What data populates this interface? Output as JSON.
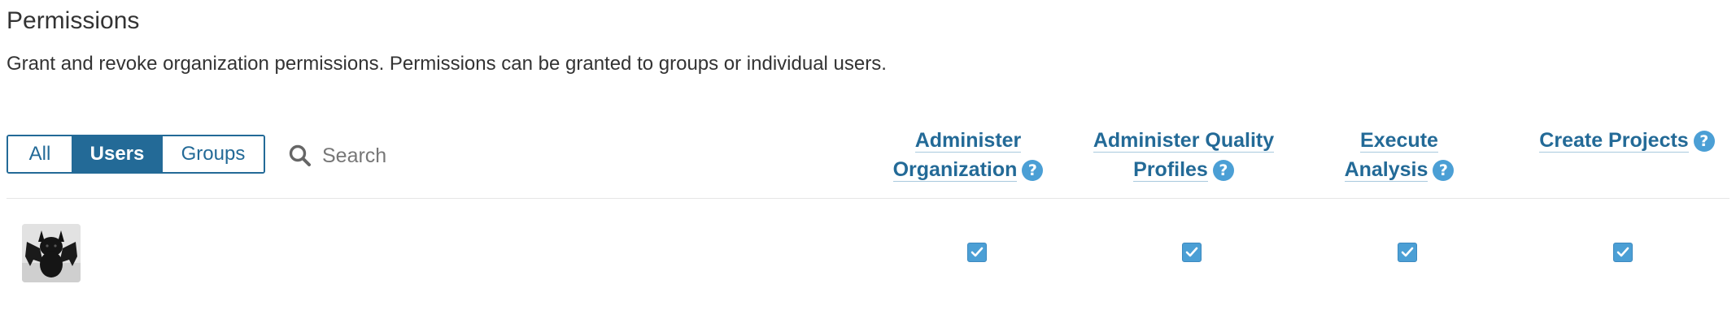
{
  "page": {
    "title": "Permissions",
    "description": "Grant and revoke organization permissions. Permissions can be granted to groups or individual users."
  },
  "filter": {
    "options": [
      "All",
      "Users",
      "Groups"
    ],
    "selected": "Users"
  },
  "search": {
    "placeholder": "Search",
    "value": ""
  },
  "permissions": [
    {
      "name_line1": "Administer",
      "name_line2": "Organization"
    },
    {
      "name_line1": "Administer Quality",
      "name_line2": "Profiles"
    },
    {
      "name_line1": "Execute",
      "name_line2": "Analysis"
    },
    {
      "name_line1": "Create Projects",
      "name_line2": ""
    }
  ],
  "users": [
    {
      "avatar": "bat-cat-avatar",
      "permissions_checked": [
        true,
        true,
        true,
        true
      ]
    }
  ],
  "icons": {
    "search": "search-icon",
    "help": "help-icon",
    "check": "check-icon"
  },
  "colors": {
    "primary": "#236a97",
    "accent": "#4b9fd5",
    "text": "#333333",
    "divider": "#e6e6e6"
  },
  "help_glyph": "?"
}
